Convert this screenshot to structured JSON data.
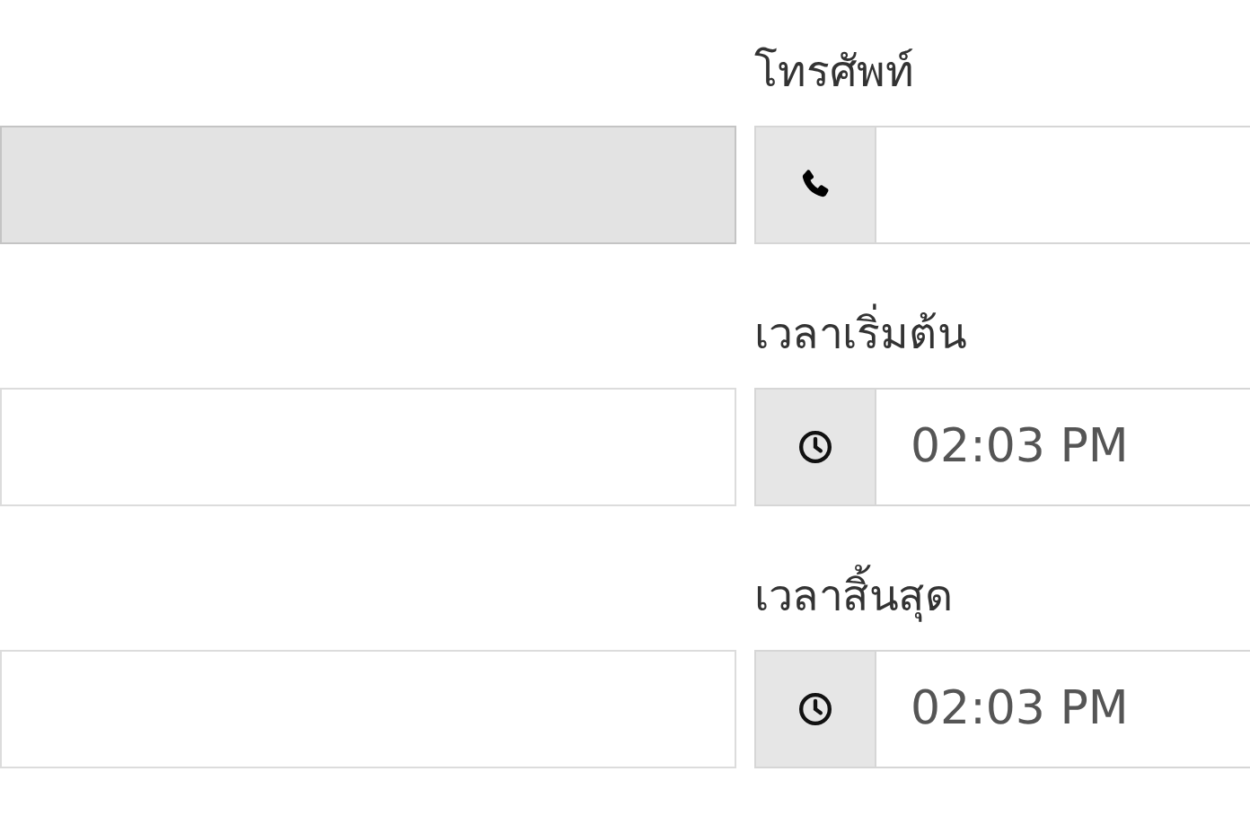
{
  "rows": [
    {
      "left_field": {
        "disabled": true
      },
      "right_field": {
        "label": "โทรศัพท์",
        "kind": "phone"
      }
    },
    {
      "left_field": {
        "disabled": false
      },
      "right_field": {
        "label": "เวลาเริ่มต้น",
        "kind": "clock",
        "value": "02:03 PM"
      }
    },
    {
      "left_field": {
        "disabled": false
      },
      "right_field": {
        "label": "เวลาสิ้นสุด",
        "kind": "clock",
        "value": "02:03 PM"
      }
    }
  ]
}
